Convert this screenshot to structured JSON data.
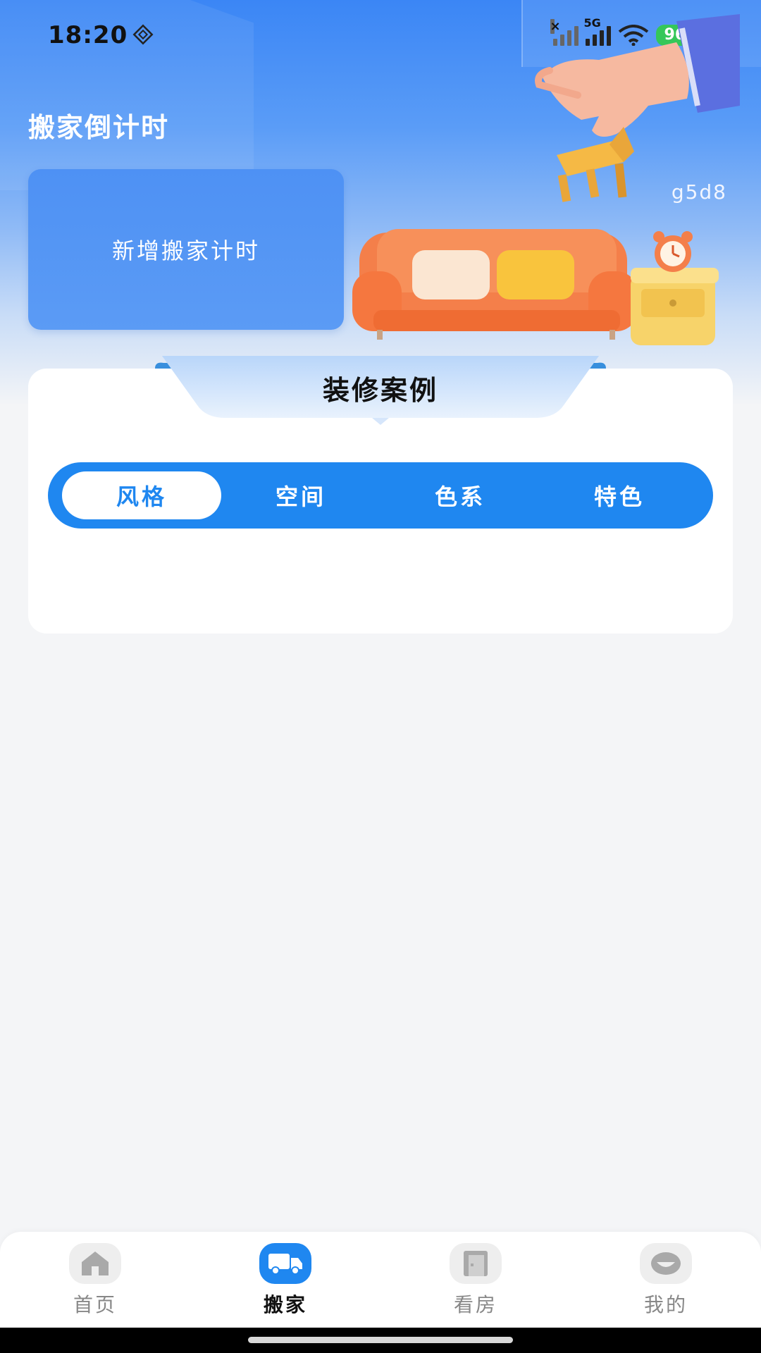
{
  "status_bar": {
    "time": "18:20",
    "network": "5G",
    "battery": "96"
  },
  "page_title": "搬家倒计时",
  "countdown_card": {
    "label": "新增搬家计时"
  },
  "watermark": "g5d8",
  "decor_section": {
    "title": "装修案例",
    "tabs": [
      {
        "label": "风格",
        "active": true
      },
      {
        "label": "空间",
        "active": false
      },
      {
        "label": "色系",
        "active": false
      },
      {
        "label": "特色",
        "active": false
      }
    ]
  },
  "bottom_nav": {
    "items": [
      {
        "label": "首页",
        "icon": "home-icon",
        "active": false
      },
      {
        "label": "搬家",
        "icon": "truck-icon",
        "active": true
      },
      {
        "label": "看房",
        "icon": "door-icon",
        "active": false
      },
      {
        "label": "我的",
        "icon": "profile-icon",
        "active": false
      }
    ]
  },
  "colors": {
    "primary": "#1f87f0",
    "card_blue": "#5b9bf5",
    "battery_green": "#35c759"
  }
}
